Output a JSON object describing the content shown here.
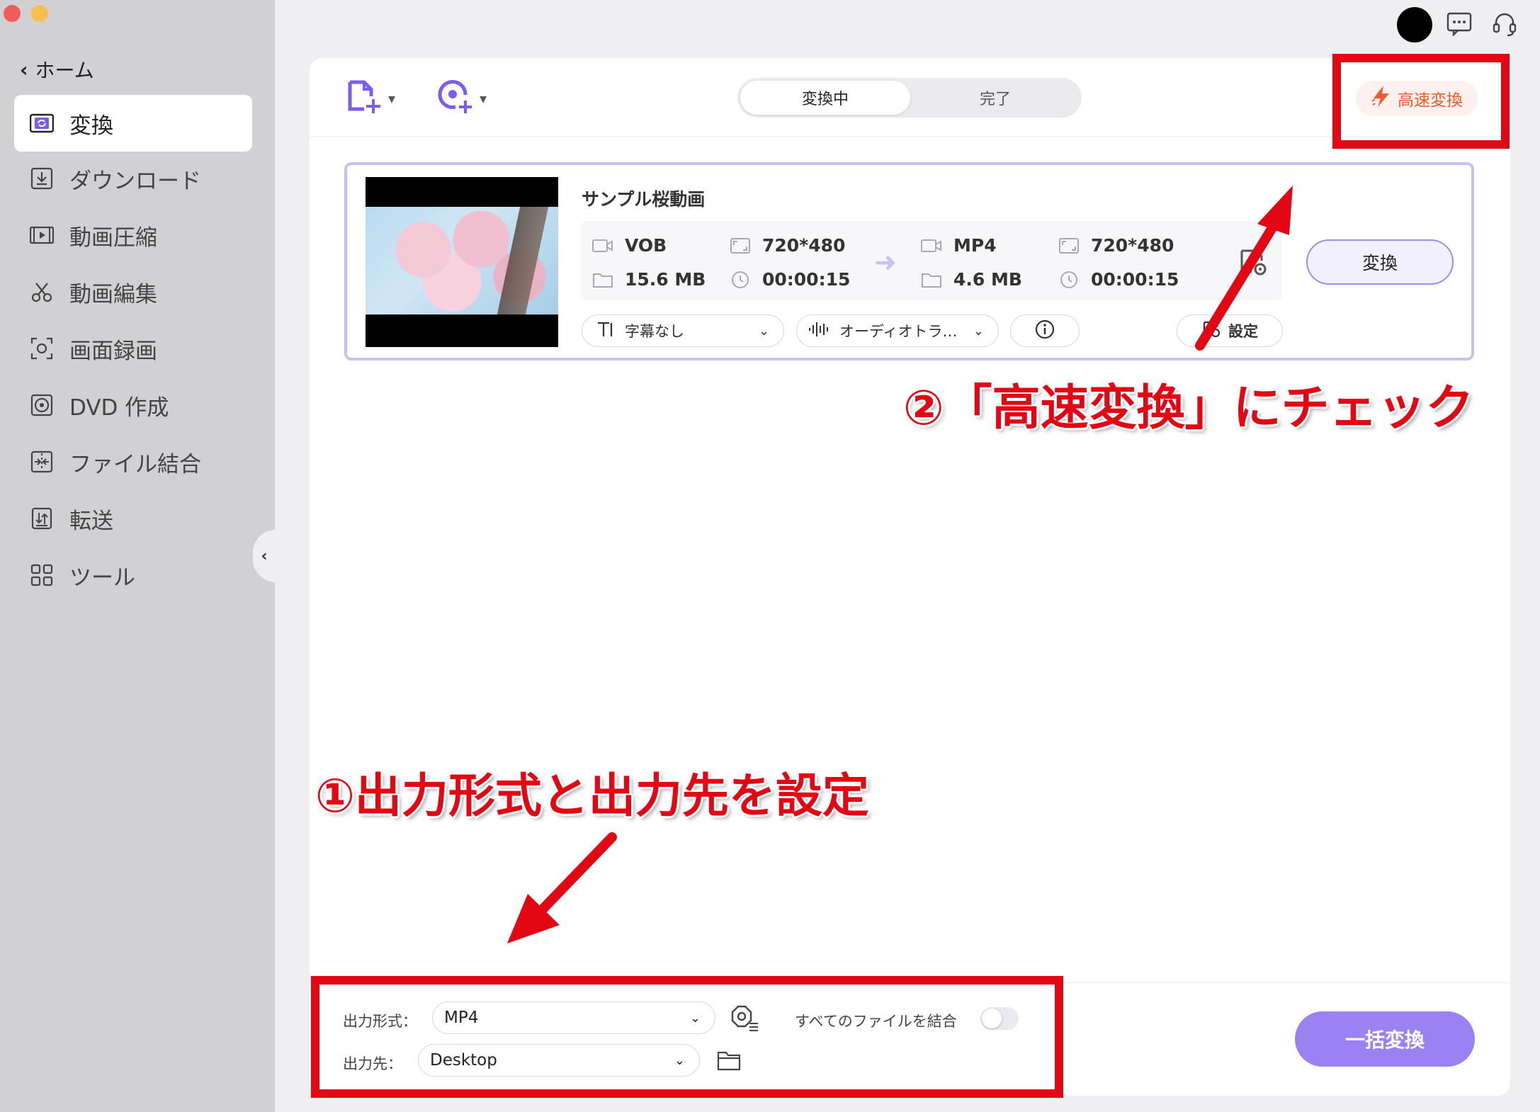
{
  "sidebar": {
    "home_label": "ホーム",
    "items": [
      {
        "label": "変換",
        "icon": "convert-icon",
        "active": true
      },
      {
        "label": "ダウンロード",
        "icon": "download-icon"
      },
      {
        "label": "動画圧縮",
        "icon": "compress-icon"
      },
      {
        "label": "動画編集",
        "icon": "scissors-icon"
      },
      {
        "label": "画面録画",
        "icon": "record-icon"
      },
      {
        "label": "DVD 作成",
        "icon": "dvd-icon"
      },
      {
        "label": "ファイル結合",
        "icon": "merge-icon"
      },
      {
        "label": "転送",
        "icon": "transfer-icon"
      },
      {
        "label": "ツール",
        "icon": "tools-icon"
      }
    ]
  },
  "tabs": {
    "converting": "変換中",
    "done": "完了"
  },
  "fast_convert_label": "高速変換",
  "file": {
    "title": "サンプル桜動画",
    "source": {
      "format": "VOB",
      "resolution": "720*480",
      "size": "15.6 MB",
      "duration": "00:00:15"
    },
    "target": {
      "format": "MP4",
      "resolution": "720*480",
      "size": "4.6 MB",
      "duration": "00:00:15"
    },
    "convert_label": "変換",
    "subtitle_label": "字幕なし",
    "audio_label": "オーディオトラ…",
    "settings_label": "設定"
  },
  "bottom": {
    "output_format_label": "出力形式：",
    "output_format_value": "MP4",
    "output_dest_label": "出力先：",
    "output_dest_value": "Desktop",
    "merge_label": "すべてのファイルを結合",
    "batch_label": "一括変換"
  },
  "annotations": {
    "step1": "①出力形式と出力先を設定",
    "step2": "②「高速変換」にチェック"
  },
  "colors": {
    "accent": "#9a82f2",
    "annotation_red": "#e30613",
    "fast_orange": "#f05a2b"
  }
}
